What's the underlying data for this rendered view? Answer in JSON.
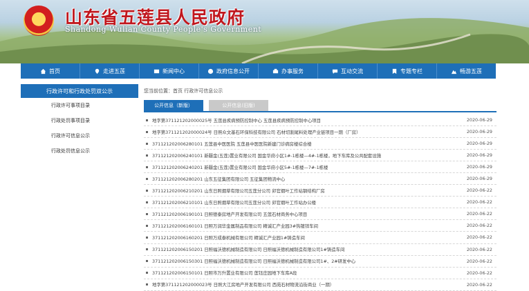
{
  "header": {
    "title": "山东省五莲县人民政府",
    "subtitle": "Shandong Wulian County People's Government",
    "emblem_icon": "national-emblem-icon"
  },
  "nav": [
    {
      "label": "首页",
      "icon": "home-icon"
    },
    {
      "label": "走进五莲",
      "icon": "location-icon"
    },
    {
      "label": "新闻中心",
      "icon": "news-icon"
    },
    {
      "label": "政府信息公开",
      "icon": "info-icon"
    },
    {
      "label": "办事服务",
      "icon": "service-icon"
    },
    {
      "label": "互动交流",
      "icon": "chat-icon"
    },
    {
      "label": "专题专栏",
      "icon": "bookmark-icon"
    },
    {
      "label": "畅游五莲",
      "icon": "tour-icon"
    }
  ],
  "sidebar": {
    "header": "行政许可和行政处罚双公示",
    "items": [
      "行政许可事项目录",
      "行政处罚事项目录",
      "行政许可信息公示",
      "行政处罚信息公示"
    ]
  },
  "breadcrumb": "您当前位置：首页 行政许可信息公示",
  "tabs": [
    {
      "label": "公开信息（新版）",
      "active": true
    },
    {
      "label": "公开信息(旧版)",
      "active": false
    }
  ],
  "rows": [
    {
      "title": "地字第371121202000025号 五莲县疾病预防控制中心 五莲县疾病预防控制中心项目",
      "date": "2020-06-29"
    },
    {
      "title": "地字第371121202000024号 日照众文基石环保科技有限公司 石材切割尾料处理产业链项目一期（厂房）",
      "date": "2020-06-29"
    },
    {
      "title": "371121202006280101 五莲县中医医院 五莲县中医医院新建门诊病房楼综合楼",
      "date": "2020-06-29"
    },
    {
      "title": "371121202006240101 新疆金(五莲)置业有限公司 国金华府小区1#-1栋楼—4#-1栋楼，地下车库及公共配套设施",
      "date": "2020-06-29"
    },
    {
      "title": "371121202006240201 新疆金(五莲)置业有限公司 国金华府小区5#-1栋楼—7#-1栋楼",
      "date": "2020-06-29"
    },
    {
      "title": "371121202006280201 山东五征集团有限公司 五征集团物流中心",
      "date": "2020-06-29"
    },
    {
      "title": "371121202006210201 山东日照烟草有限公司五莲分公司 卯官烟叶工作站钢结构厂房",
      "date": "2020-06-22"
    },
    {
      "title": "371121202006210101 山东日照烟草有限公司五莲分公司 卯官烟叶工作站办公楼",
      "date": "2020-06-22"
    },
    {
      "title": "371121202006190101 日照德泰房地产开发有限公司 五莲石材商务中心项目",
      "date": "2020-06-22"
    },
    {
      "title": "371121202006160101 日照万润华金属制品有限公司 精诚汇产业园3#热镀锌车间",
      "date": "2020-06-22"
    },
    {
      "title": "371121202006160201 日照万成泰机械有限公司 精诚汇产业园1#铸造车间",
      "date": "2020-06-22"
    },
    {
      "title": "371121202006150201 日照福沃德机械制造有限公司 日照福沃德机械制造有限公司1#铸造车间",
      "date": "2020-06-22"
    },
    {
      "title": "371121202006150301 日照福沃德机械制造有限公司 日照福沃德机械制造有限公司1#、2#研发中心",
      "date": "2020-06-22"
    },
    {
      "title": "371121202006150101 日照市万升置业有限公司 莲钰庄园地下车库A段",
      "date": "2020-06-22"
    },
    {
      "title": "地字第371121202000023号 日照大江房地产开发有限公司 西苑石材物流沿街商业（一期）",
      "date": "2020-06-22"
    }
  ]
}
